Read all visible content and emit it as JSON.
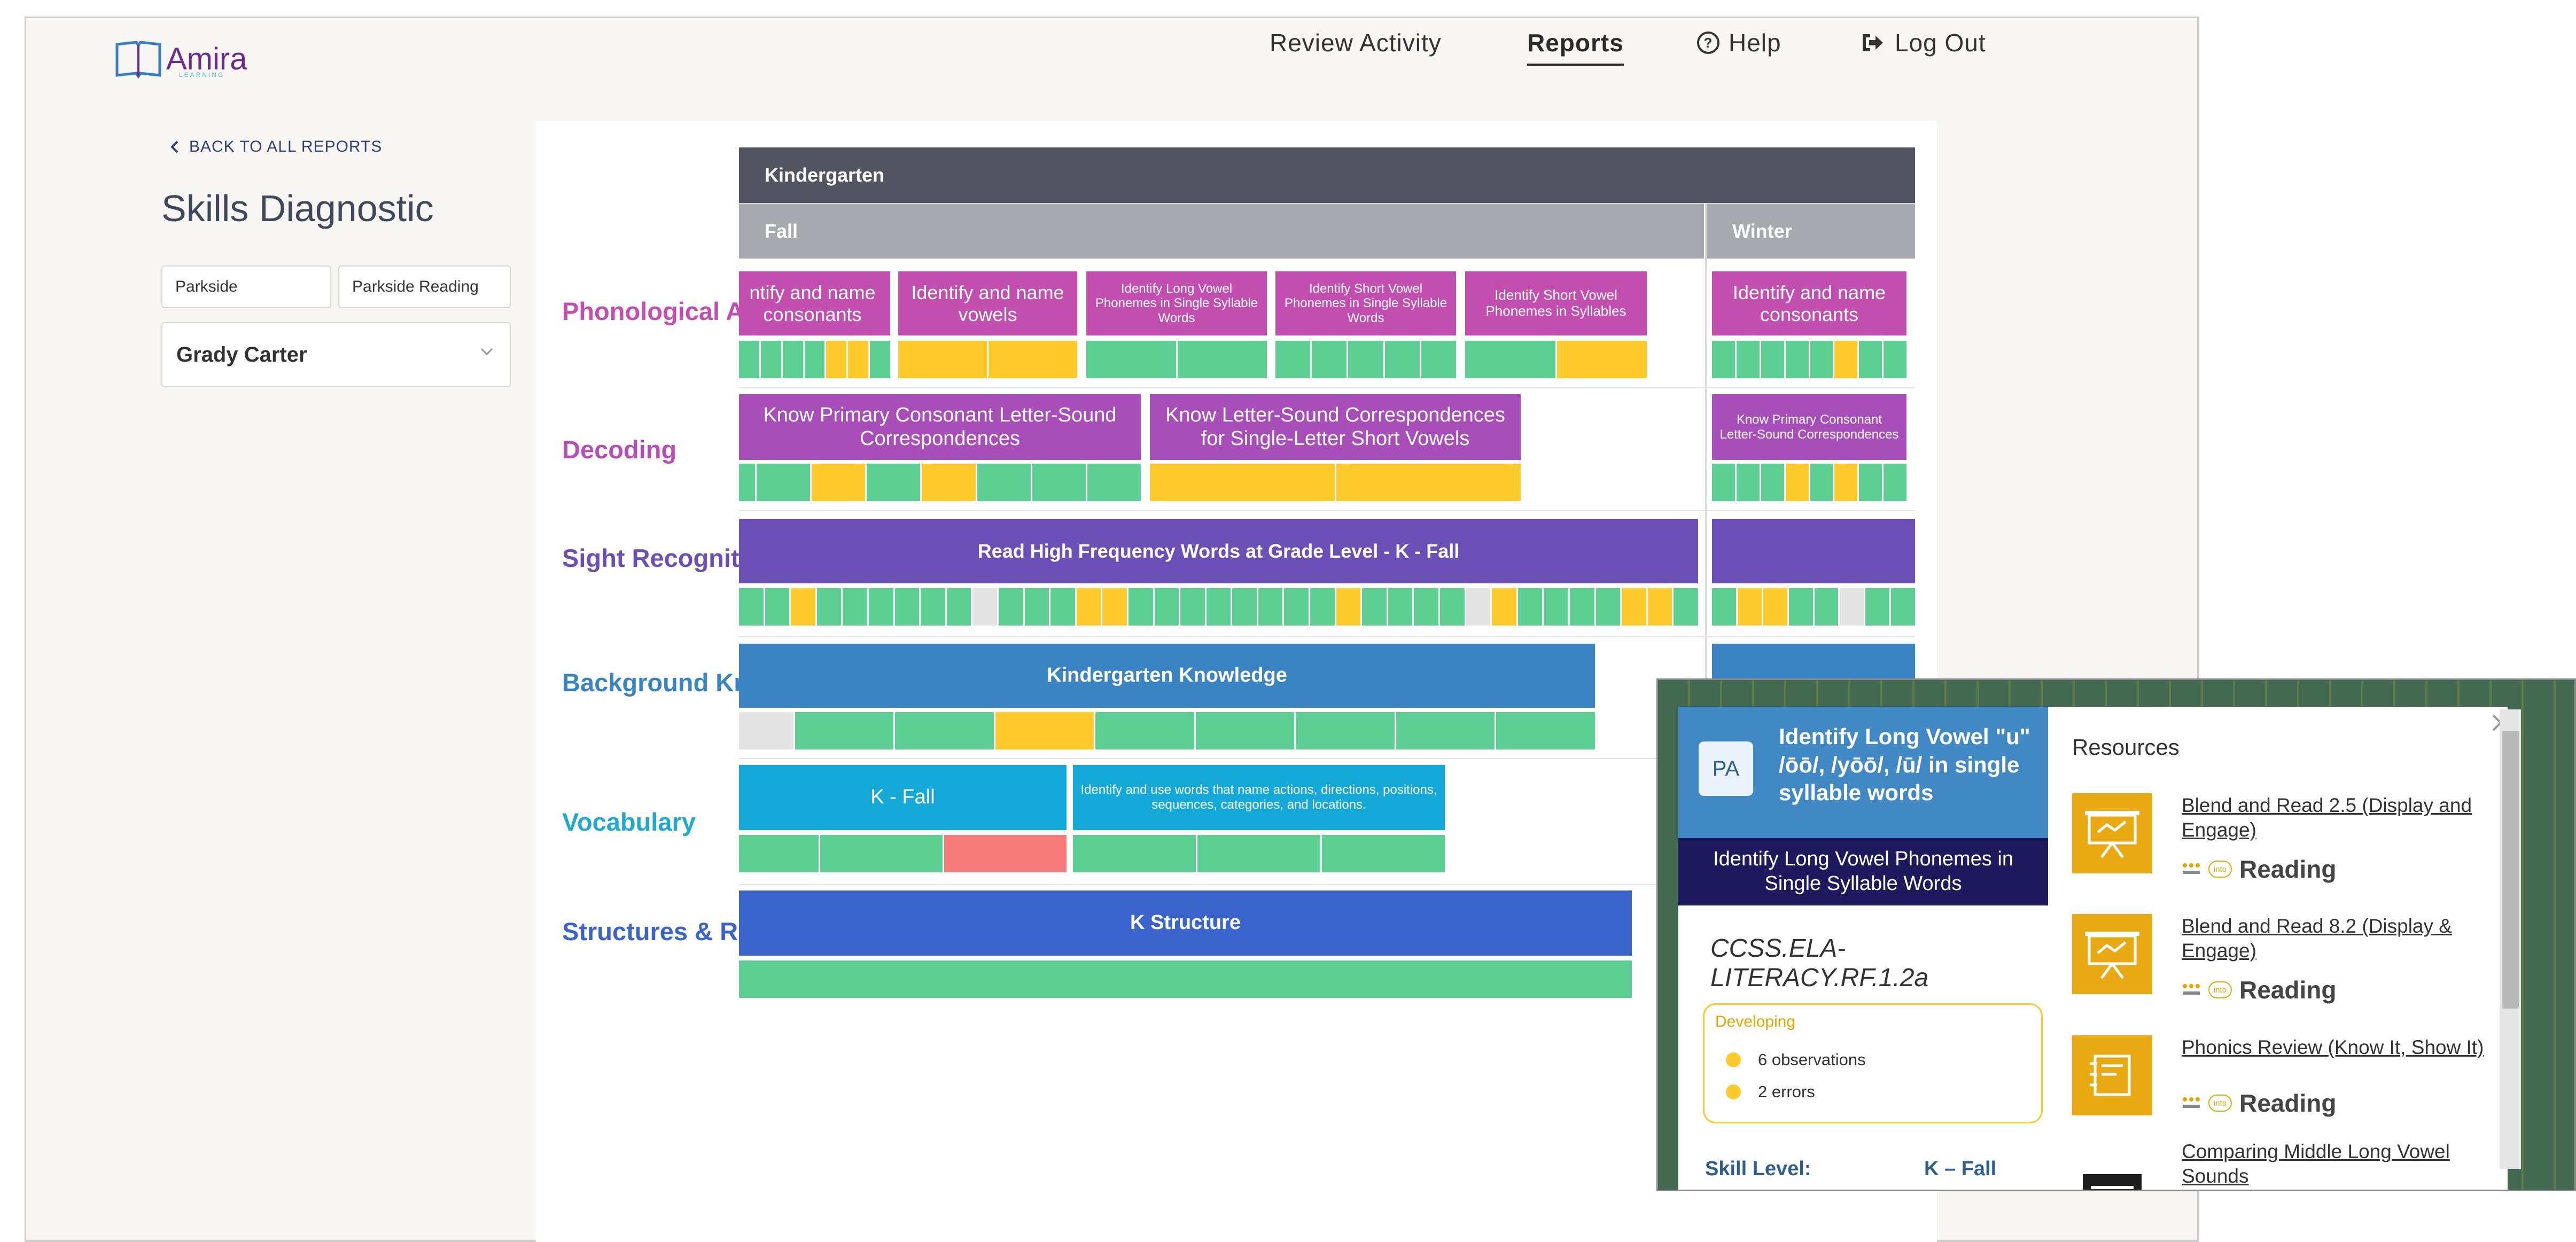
{
  "header": {
    "logo_text": "Amira",
    "logo_sub": "LEARNING",
    "nav": {
      "review_activity": "Review Activity",
      "reports": "Reports",
      "help": "Help",
      "logout": "Log Out"
    }
  },
  "sidebar": {
    "back_label": "BACK TO ALL REPORTS",
    "page_title": "Skills Diagnostic",
    "school": "Parkside",
    "class": "Parkside Reading",
    "student": "Grady Carter"
  },
  "grid": {
    "grade": "Kindergarten",
    "seasons": [
      "Fall",
      "Winter"
    ],
    "rows": [
      {
        "label": "Phonological Awareness",
        "color": "#c24fb0"
      },
      {
        "label": "Decoding",
        "color": "#b44fb3"
      },
      {
        "label": "Sight Recognition",
        "color": "#6a4fb6"
      },
      {
        "label": "Background Knowledge",
        "color": "#3a84c4"
      },
      {
        "label": "Vocabulary",
        "color": "#1fa9cf"
      },
      {
        "label": "Structures & Reasoning",
        "color": "#3a63cc"
      }
    ],
    "skills": {
      "pa1": "ntify and name consonants",
      "pa2": "Identify and name vowels",
      "pa3": "Identify Long Vowel Phonemes in Single Syllable Words",
      "pa4": "Identify Short Vowel Phonemes in Single Syllable Words",
      "pa5": "Identify Short Vowel Phonemes in Syllables",
      "pa_w": "Identify and name consonants",
      "dec1": "Know Primary Consonant Letter-Sound Correspondences",
      "dec2": "Know Letter-Sound Correspondences for Single-Letter Short Vowels",
      "dec_w": "Know Primary Consonant Letter-Sound Correspondences",
      "sight1": "Read High Frequency Words at Grade Level - K - Fall",
      "bg1": "Kindergarten Knowledge",
      "voc1": "K - Fall",
      "voc2": "Identify and use words that name actions, directions, positions, sequences, categories, and locations.",
      "str1": "K Structure"
    },
    "colors": {
      "mastered": "#5ecf93",
      "developing": "#ffca2c",
      "struggling": "#f67c7c",
      "not_assessed": "#e4e4e4"
    }
  },
  "popup": {
    "badge": "PA",
    "title": "Identify Long Vowel \"u\" /ōō/, /yōō/, /ū/ in single syllable words",
    "subtitle": "Identify Long Vowel Phonemes in Single Syllable Words",
    "standard": "CCSS.ELA-LITERACY.RF.1.2a",
    "status": "Developing",
    "observations": "6 observations",
    "errors": "2 errors",
    "skill_level_label": "Skill Level:",
    "skill_level_value": "K – Fall",
    "resources_title": "Resources",
    "resources": [
      {
        "title": "Blend and Read 2.5 (Display and Engage)",
        "brand": "Reading",
        "icon": "presentation-icon"
      },
      {
        "title": "Blend and Read 8.2 (Display & Engage)",
        "brand": "Reading",
        "icon": "presentation-icon"
      },
      {
        "title": "Phonics Review (Know It, Show It)",
        "brand": "Reading",
        "icon": "notebook-icon"
      },
      {
        "title": "Comparing Middle Long Vowel Sounds",
        "brand": "",
        "icon": "document-icon"
      }
    ]
  }
}
